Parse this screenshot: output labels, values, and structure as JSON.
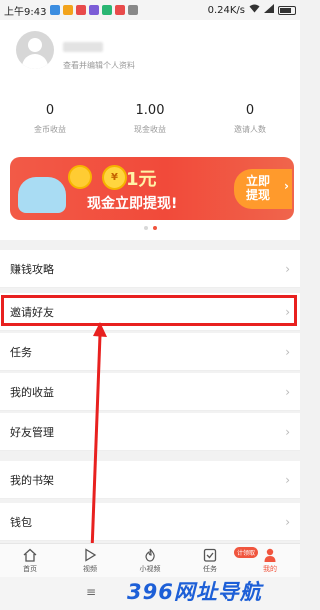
{
  "statusbar": {
    "time": "上午9:43",
    "network": "0.24K/s"
  },
  "profile": {
    "edit_hint": "查看并编辑个人资料"
  },
  "stats": [
    {
      "value": "0",
      "label": "金币收益"
    },
    {
      "value": "1.00",
      "label": "现金收益"
    },
    {
      "value": "0",
      "label": "邀请人数"
    }
  ],
  "banner": {
    "coin_symbol": "¥",
    "amount": "1元",
    "headline": "现金立即提现!",
    "cta": "立即提现",
    "cta_line1": "立即",
    "cta_line2": "提现"
  },
  "menu": [
    {
      "label": "赚钱攻略"
    },
    {
      "label": "邀请好友"
    },
    {
      "label": "任务"
    },
    {
      "label": "我的收益"
    },
    {
      "label": "好友管理"
    },
    {
      "label": "我的书架"
    },
    {
      "label": "钱包"
    }
  ],
  "tabs": [
    {
      "label": "首页",
      "icon": "home-icon"
    },
    {
      "label": "视频",
      "icon": "play-icon"
    },
    {
      "label": "小视频",
      "icon": "flame-icon"
    },
    {
      "label": "任务",
      "icon": "task-icon",
      "badge": "计领取"
    },
    {
      "label": "我的",
      "icon": "person-icon"
    }
  ],
  "watermark": "396网址导航",
  "colors": {
    "accent": "#f1553e",
    "highlight": "#e8201f",
    "watermark": "#1d5fd7"
  }
}
